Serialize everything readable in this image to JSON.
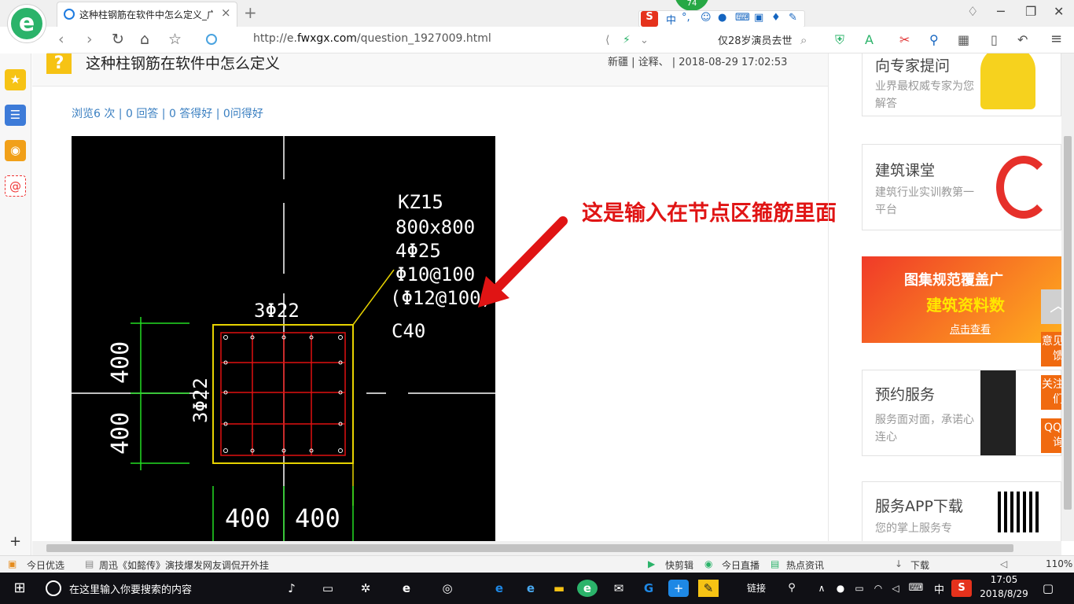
{
  "browser": {
    "logo_glyph": "e",
    "tab_title": "这种柱钢筋在软件中怎么定义_广",
    "tab_close": "×",
    "new_tab": "+",
    "badge_count": "74",
    "url_protocol": "http://e.",
    "url_domain": "fwxgx.com",
    "url_path": "/question_1927009.html",
    "search_text": "仅28岁演员去世",
    "ime_label": "中",
    "ime_punct": "°,",
    "accent_color": "#2bb36a"
  },
  "sidebar": {
    "add": "+"
  },
  "page": {
    "qmark": "?",
    "title": "这种柱钢筋在软件中怎么定义",
    "meta": "新疆 | 诠释、  | 2018-08-29 17:02:53",
    "stats": "浏览6 次 | 0 回答 | 0 答得好 | 0问得好",
    "annotation": "这是输入在节点区箍筋里面",
    "annotation_color": "#e01414"
  },
  "cad": {
    "line1": "KZ15",
    "line2": "800x800",
    "line3": "4Φ25",
    "line4": "Φ10@100",
    "line5": "(Φ12@100)",
    "line6": "C40",
    "top_bars": "3Φ22",
    "side_bars": "3Φ22",
    "dim_v_top": "400",
    "dim_v_bottom": "400",
    "dim_h_left": "400",
    "dim_h_right": "400"
  },
  "right": {
    "card1_title": "向专家提问",
    "card1_desc": "业界最权威专家为您解答",
    "card2_title": "建筑课堂",
    "card2_desc": "建筑行业实训教第一平台",
    "banner_line1": "图集规范覆盖广",
    "banner_line2": "建筑资料数",
    "banner_btn": "点击查看",
    "card3_title": "预约服务",
    "card3_desc": "服务面对面，承诺心连心",
    "card4_title": "服务APP下载",
    "card4_desc": "您的掌上服务专",
    "float_feedback": "意见反馈",
    "float_follow": "关注我们",
    "float_qq": "QQ咨询"
  },
  "statusbar": {
    "left1": "今日优选",
    "left2": "周迅《如懿传》演技爆发网友调侃开外挂",
    "r1": "快剪辑",
    "r2": "今日直播",
    "r3": "热点资讯",
    "r4": "下载",
    "zoom": "110%"
  },
  "taskbar": {
    "search_placeholder": "在这里输入你要搜索的内容",
    "links": "链接",
    "ime": "中",
    "time": "17:05",
    "date": "2018/8/29"
  }
}
